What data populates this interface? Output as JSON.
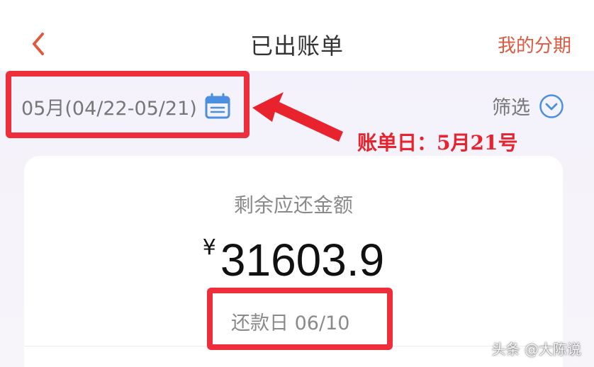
{
  "header": {
    "back_icon": "chevron-left-icon",
    "title": "已出账单",
    "right_link": "我的分期"
  },
  "period": {
    "label": "05月(04/22-05/21)",
    "icon": "calendar-icon"
  },
  "filter": {
    "label": "筛选",
    "icon": "chevron-down-circle-icon"
  },
  "card": {
    "label": "剩余应还金额",
    "currency": "¥",
    "amount": "31603.9",
    "due_date": "还款日 06/10"
  },
  "annotations": {
    "statement_day_note": "账单日：5月21号"
  },
  "watermark": "头条 @大陈说",
  "colors": {
    "accent": "#e05a3f",
    "annotation_red": "#ee2e3a",
    "icon_blue": "#4a8fe0",
    "text_gray": "#777777",
    "amount_black": "#111111"
  }
}
